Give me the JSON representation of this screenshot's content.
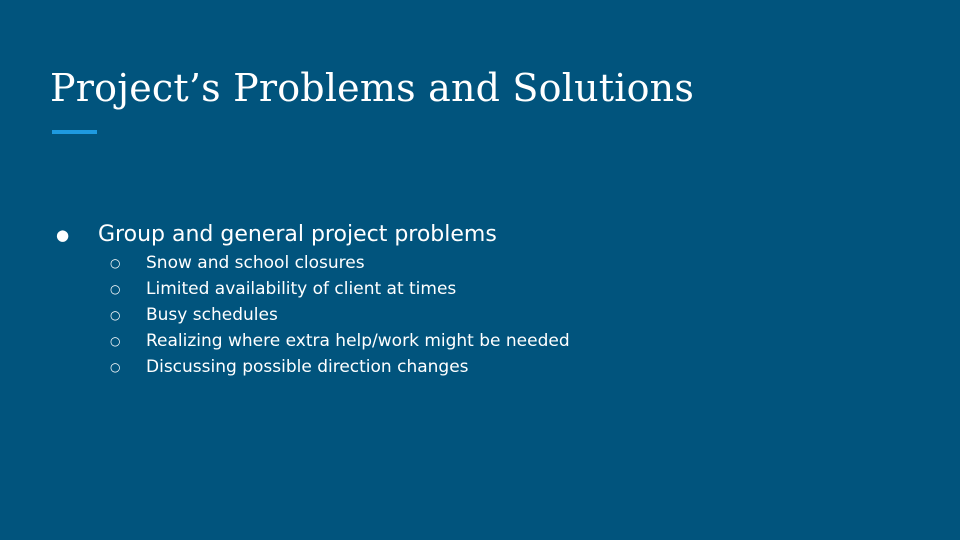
{
  "slide": {
    "title": "Project’s Problems and Solutions",
    "accent_color": "#1e9ae0",
    "background_color": "#01547d",
    "bullets": [
      {
        "marker": "●",
        "text": "Group and general project problems",
        "sub_marker": "○",
        "sub_items": [
          "Snow and school closures",
          "Limited availability of client at times",
          "Busy schedules",
          "Realizing where extra help/work might be needed",
          "Discussing possible direction changes"
        ]
      }
    ]
  }
}
